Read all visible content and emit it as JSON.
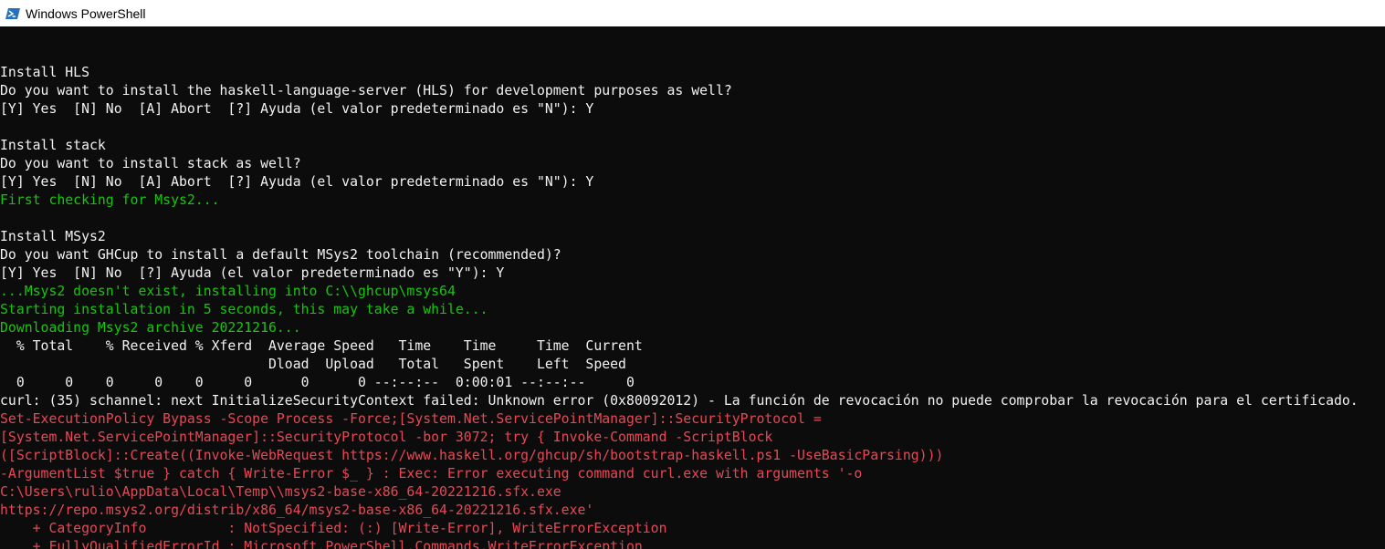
{
  "window": {
    "title": "Windows PowerShell",
    "icon": "powershell-icon"
  },
  "colors": {
    "background": "#0c0c0c",
    "text": "#f2f2f2",
    "green": "#16c60c",
    "red": "#e74856"
  },
  "console": {
    "lines": [
      {
        "text": "",
        "color": "default"
      },
      {
        "text": "Install HLS",
        "color": "default"
      },
      {
        "text": "Do you want to install the haskell-language-server (HLS) for development purposes as well?",
        "color": "default"
      },
      {
        "text": "[Y] Yes  [N] No  [A] Abort  [?] Ayuda (el valor predeterminado es \"N\"): Y",
        "color": "default"
      },
      {
        "text": "",
        "color": "default"
      },
      {
        "text": "Install stack",
        "color": "default"
      },
      {
        "text": "Do you want to install stack as well?",
        "color": "default"
      },
      {
        "text": "[Y] Yes  [N] No  [A] Abort  [?] Ayuda (el valor predeterminado es \"N\"): Y",
        "color": "default"
      },
      {
        "text": "First checking for Msys2...",
        "color": "green"
      },
      {
        "text": "",
        "color": "default"
      },
      {
        "text": "Install MSys2",
        "color": "default"
      },
      {
        "text": "Do you want GHCup to install a default MSys2 toolchain (recommended)?",
        "color": "default"
      },
      {
        "text": "[Y] Yes  [N] No  [?] Ayuda (el valor predeterminado es \"Y\"): Y",
        "color": "default"
      },
      {
        "text": "...Msys2 doesn't exist, installing into C:\\\\ghcup\\msys64",
        "color": "green"
      },
      {
        "text": "Starting installation in 5 seconds, this may take a while...",
        "color": "green"
      },
      {
        "text": "Downloading Msys2 archive 20221216...",
        "color": "green"
      },
      {
        "text": "  % Total    % Received % Xferd  Average Speed   Time    Time     Time  Current",
        "color": "default"
      },
      {
        "text": "                                 Dload  Upload   Total   Spent    Left  Speed",
        "color": "default"
      },
      {
        "text": "  0     0    0     0    0     0      0      0 --:--:--  0:00:01 --:--:--     0",
        "color": "default"
      },
      {
        "text": "curl: (35) schannel: next InitializeSecurityContext failed: Unknown error (0x80092012) - La función de revocación no puede comprobar la revocación para el certificado.",
        "color": "default"
      },
      {
        "text": "Set-ExecutionPolicy Bypass -Scope Process -Force;[System.Net.ServicePointManager]::SecurityProtocol =",
        "color": "red"
      },
      {
        "text": "[System.Net.ServicePointManager]::SecurityProtocol -bor 3072; try { Invoke-Command -ScriptBlock",
        "color": "red"
      },
      {
        "text": "([ScriptBlock]::Create((Invoke-WebRequest https://www.haskell.org/ghcup/sh/bootstrap-haskell.ps1 -UseBasicParsing)))",
        "color": "red"
      },
      {
        "text": "-ArgumentList $true } catch { Write-Error $_ } : Exec: Error executing command curl.exe with arguments '-o",
        "color": "red"
      },
      {
        "text": "C:\\Users\\rulio\\AppData\\Local\\Temp\\\\msys2-base-x86_64-20221216.sfx.exe",
        "color": "red"
      },
      {
        "text": "https://repo.msys2.org/distrib/x86_64/msys2-base-x86_64-20221216.sfx.exe'",
        "color": "red"
      },
      {
        "text": "    + CategoryInfo          : NotSpecified: (:) [Write-Error], WriteErrorException",
        "color": "red"
      },
      {
        "text": "    + FullyQualifiedErrorId : Microsoft.PowerShell.Commands.WriteErrorException",
        "color": "red"
      }
    ]
  }
}
